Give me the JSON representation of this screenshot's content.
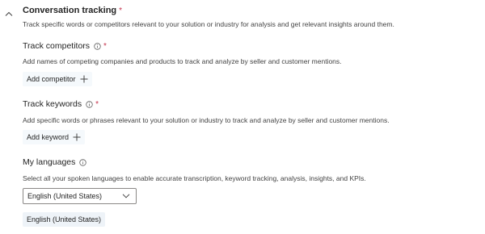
{
  "header": {
    "title": "Conversation tracking",
    "required_mark": "*",
    "description": "Track specific words or competitors relevant to your solution or industry for analysis and get relevant insights around them."
  },
  "competitors": {
    "title": "Track competitors",
    "required_mark": "*",
    "description": "Add names of competing companies and products to track and analyze by seller and customer mentions.",
    "button_label": "Add competitor"
  },
  "keywords": {
    "title": "Track keywords",
    "required_mark": "*",
    "description": "Add specific words or phrases relevant to your solution or industry to track and analyze by seller and customer mentions.",
    "button_label": "Add keyword"
  },
  "languages": {
    "title": "My languages",
    "description": "Select all your spoken languages to enable accurate transcription, keyword tracking, analysis, insights, and KPIs.",
    "selected_value": "English (United States)",
    "selected_tags": [
      "English (United States)"
    ]
  },
  "icons": {
    "collapse": "chevron-up-icon",
    "info": "info-icon",
    "add": "plus-icon",
    "dropdown": "chevron-down-icon"
  },
  "colors": {
    "required": "#c4314b",
    "text": "#242424",
    "button_bg": "#f5f9fc",
    "tag_bg": "#eef3f8"
  }
}
